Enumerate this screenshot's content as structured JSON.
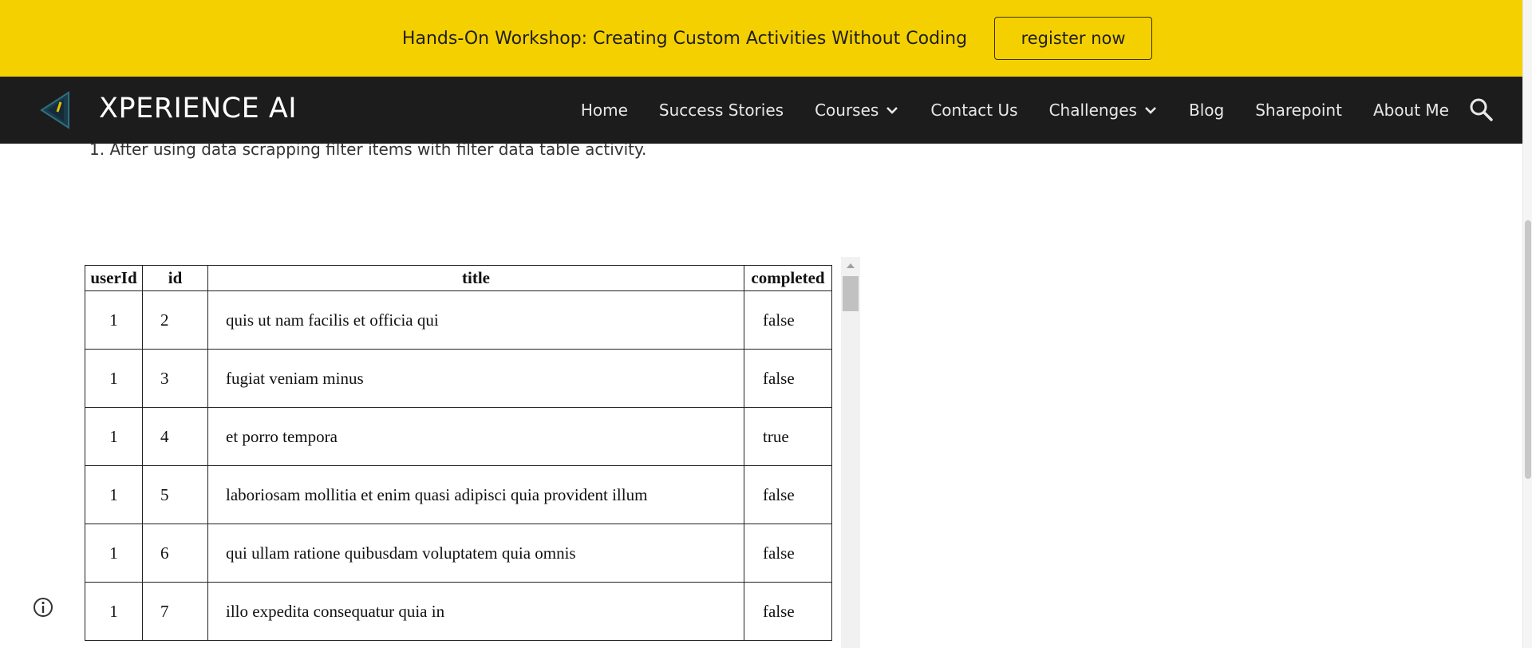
{
  "banner": {
    "text": "Hands-On Workshop: Creating Custom Activities Without Coding",
    "button_label": "register now",
    "background_color": "#f5d000"
  },
  "nav": {
    "logo_icon": "xperience-logo-icon",
    "site_title": "XPERIENCE AI",
    "items": [
      {
        "label": "Home",
        "has_dropdown": false
      },
      {
        "label": "Success Stories",
        "has_dropdown": false
      },
      {
        "label": "Courses",
        "has_dropdown": true
      },
      {
        "label": "Contact Us",
        "has_dropdown": false
      },
      {
        "label": "Challenges",
        "has_dropdown": true
      },
      {
        "label": "Blog",
        "has_dropdown": false
      },
      {
        "label": "Sharepoint",
        "has_dropdown": false
      },
      {
        "label": "About Me",
        "has_dropdown": false
      }
    ],
    "search_icon": "search-icon",
    "background_color": "#1c1c1c"
  },
  "content": {
    "list_item": "1. After using data scrapping filter items with filter data table activity."
  },
  "table": {
    "headers": [
      "userId",
      "id",
      "title",
      "completed"
    ],
    "rows": [
      [
        "1",
        "2",
        "quis ut nam facilis et officia qui",
        "false"
      ],
      [
        "1",
        "3",
        "fugiat veniam minus",
        "false"
      ],
      [
        "1",
        "4",
        "et porro tempora",
        "true"
      ],
      [
        "1",
        "5",
        "laboriosam mollitia et enim quasi adipisci quia provident illum",
        "false"
      ],
      [
        "1",
        "6",
        "qui ullam ratione quibusdam voluptatem quia omnis",
        "false"
      ],
      [
        "1",
        "7",
        "illo expedita consequatur quia in",
        "false"
      ]
    ]
  },
  "footer": {
    "info_icon": "info-icon"
  }
}
